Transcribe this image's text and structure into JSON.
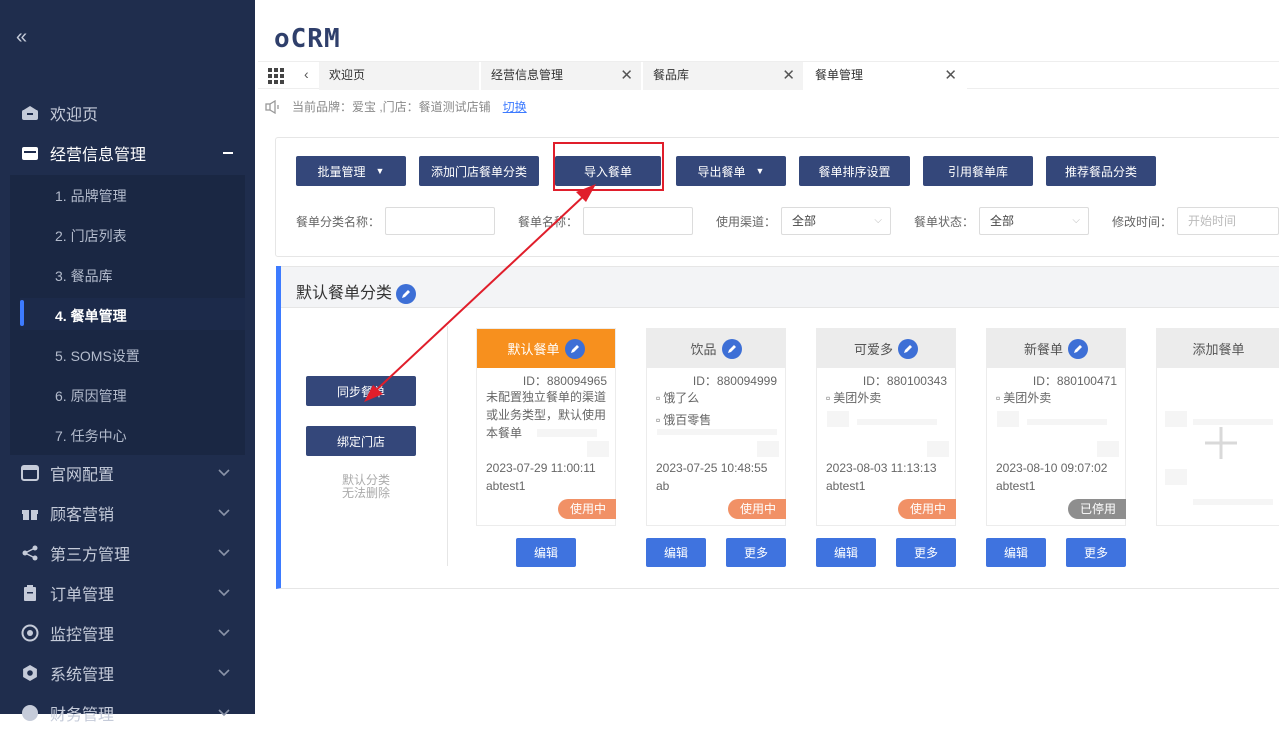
{
  "sidebar": {
    "groups": [
      {
        "label": "欢迎页"
      },
      {
        "label": "经营信息管理"
      },
      {
        "label": "官网配置"
      },
      {
        "label": "顾客营销"
      },
      {
        "label": "第三方管理"
      },
      {
        "label": "订单管理"
      },
      {
        "label": "监控管理"
      },
      {
        "label": "系统管理"
      },
      {
        "label": "财务管理"
      }
    ],
    "sub_items": [
      {
        "label": "1. 品牌管理"
      },
      {
        "label": "2. 门店列表"
      },
      {
        "label": "3. 餐品库"
      },
      {
        "label": "4. 餐单管理"
      },
      {
        "label": "5. SOMS设置"
      },
      {
        "label": "6. 原因管理"
      },
      {
        "label": "7. 任务中心"
      }
    ]
  },
  "logo": "oCRM",
  "tabs": [
    {
      "label": "欢迎页"
    },
    {
      "label": "经营信息管理"
    },
    {
      "label": "餐品库"
    },
    {
      "label": "餐单管理"
    }
  ],
  "brand_line": {
    "text": "当前品牌：爱宝   ,门店：餐道测试店铺",
    "switch_label": "切换"
  },
  "toolbar": {
    "batch": "批量管理",
    "add_category": "添加门店餐单分类",
    "import": "导入餐单",
    "export": "导出餐单",
    "sort": "餐单排序设置",
    "quote": "引用餐单库",
    "recommend": "推荐餐品分类"
  },
  "filters": {
    "category_name_label": "餐单分类名称：",
    "menu_name_label": "餐单名称：",
    "channel_label": "使用渠道：",
    "channel_value": "全部",
    "status_label": "餐单状态：",
    "status_value": "全部",
    "modified_label": "修改时间：",
    "modified_placeholder": "开始时间"
  },
  "section": {
    "title": "默认餐单分类",
    "sync_btn": "同步餐单",
    "bind_btn": "绑定门店",
    "note_line1": "默认分类",
    "note_line2": "无法删除"
  },
  "cards": [
    {
      "title": "默认餐单",
      "id": "ID：880094965",
      "lines": [
        "未配置独立餐单的渠道或业务类型，默认使用本餐单"
      ],
      "time": "2023-07-29 11:00:11",
      "user": "abtest1",
      "status": "使用中",
      "edit": "编辑"
    },
    {
      "title": "饮品",
      "id": "ID：880094999",
      "lines": [
        "饿了么",
        "饿百零售"
      ],
      "time": "2023-07-25 10:48:55",
      "user": "ab",
      "status": "使用中",
      "edit": "编辑",
      "more": "更多"
    },
    {
      "title": "可爱多",
      "id": "ID：880100343",
      "lines": [
        "美团外卖"
      ],
      "time": "2023-08-03 11:13:13",
      "user": "abtest1",
      "status": "使用中",
      "edit": "编辑",
      "more": "更多"
    },
    {
      "title": "新餐单",
      "id": "ID：880100471",
      "lines": [
        "美团外卖"
      ],
      "time": "2023-08-10 09:07:02",
      "user": "abtest1",
      "status": "已停用",
      "edit": "编辑",
      "more": "更多"
    }
  ],
  "add_card": {
    "title": "添加餐单"
  },
  "colors": {
    "sidebar": "#1f2d4d",
    "button": "#34477a",
    "accent": "#3d7bff",
    "orange": "#f7901e",
    "annotation": "#e01e2b"
  }
}
